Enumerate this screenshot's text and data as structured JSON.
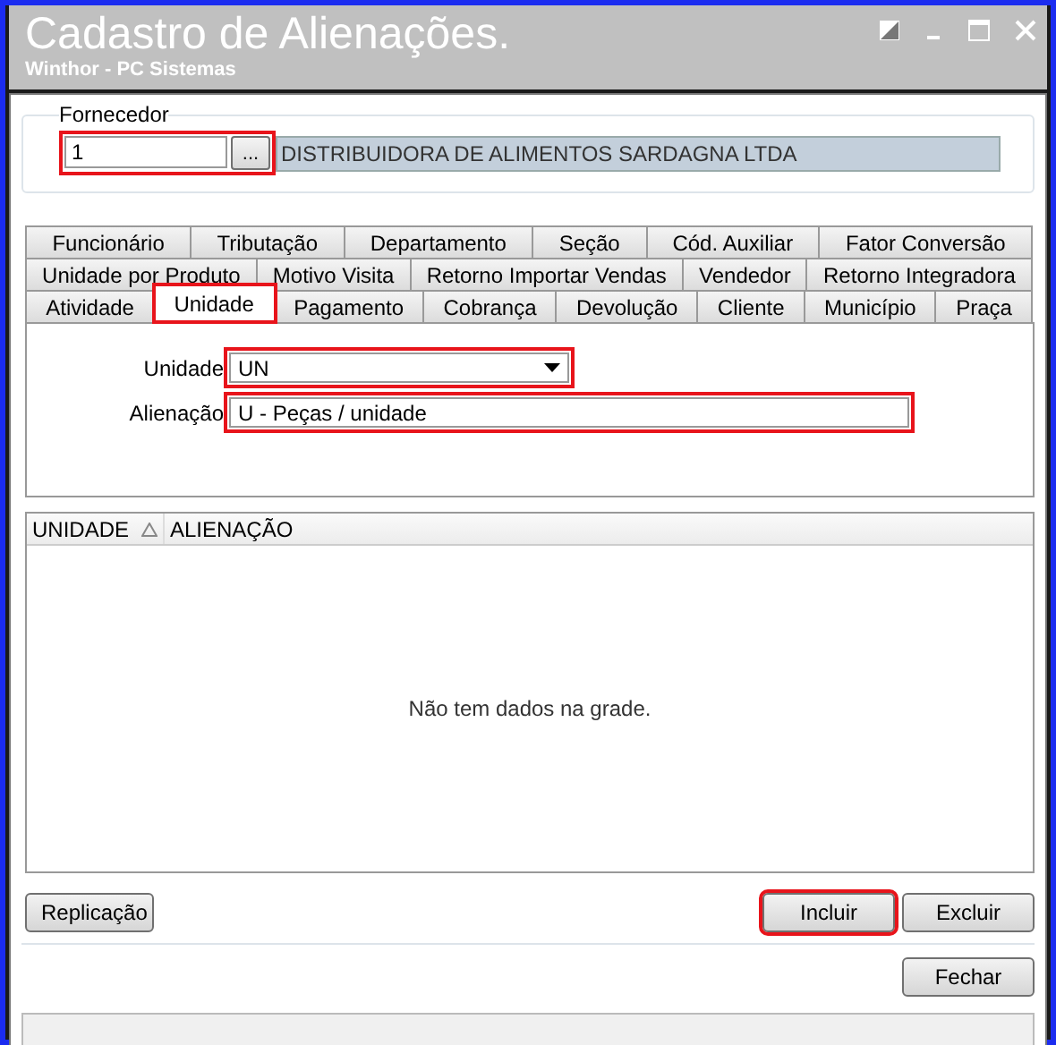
{
  "window": {
    "title": "Cadastro de Alienações.",
    "subtitle": "Winthor - PC Sistemas"
  },
  "fornecedor": {
    "label": "Fornecedor",
    "code": "1",
    "browse": "...",
    "name": "DISTRIBUIDORA DE ALIMENTOS SARDAGNA LTDA",
    "highlighted": true
  },
  "tab_rows": [
    [
      {
        "label": "Funcionário",
        "selected": false,
        "highlighted": false
      },
      {
        "label": "Tributação",
        "selected": false,
        "highlighted": false
      },
      {
        "label": "Departamento",
        "selected": false,
        "highlighted": false
      },
      {
        "label": "Seção",
        "selected": false,
        "highlighted": false
      },
      {
        "label": "Cód. Auxiliar",
        "selected": false,
        "highlighted": false
      },
      {
        "label": "Fator Conversão",
        "selected": false,
        "highlighted": false
      }
    ],
    [
      {
        "label": "Unidade por Produto",
        "selected": false,
        "highlighted": false
      },
      {
        "label": "Motivo Visita",
        "selected": false,
        "highlighted": false
      },
      {
        "label": "Retorno Importar Vendas",
        "selected": false,
        "highlighted": false
      },
      {
        "label": "Vendedor",
        "selected": false,
        "highlighted": false
      },
      {
        "label": "Retorno Integradora",
        "selected": false,
        "highlighted": false
      }
    ],
    [
      {
        "label": "Atividade",
        "selected": false,
        "highlighted": false
      },
      {
        "label": "Unidade",
        "selected": true,
        "highlighted": true
      },
      {
        "label": "Pagamento",
        "selected": false,
        "highlighted": false
      },
      {
        "label": "Cobrança",
        "selected": false,
        "highlighted": false
      },
      {
        "label": "Devolução",
        "selected": false,
        "highlighted": false
      },
      {
        "label": "Cliente",
        "selected": false,
        "highlighted": false
      },
      {
        "label": "Município",
        "selected": false,
        "highlighted": false
      },
      {
        "label": "Praça",
        "selected": false,
        "highlighted": false
      }
    ]
  ],
  "fields": [
    {
      "kind": "dropdown",
      "label": "Unidade",
      "value": "UN",
      "highlighted": true
    },
    {
      "kind": "text",
      "label": "Alienação",
      "value": "U - Peças / unidade",
      "highlighted": true
    }
  ],
  "grid": {
    "columns": [
      {
        "label": "UNIDADE",
        "sorted": true
      },
      {
        "label": "ALIENAÇÃO",
        "sorted": false
      }
    ],
    "empty_message": "Não tem dados na grade."
  },
  "left_buttons": [
    {
      "label": "Replicação",
      "highlighted": false
    }
  ],
  "right_buttons": [
    {
      "label": "Incluir",
      "highlighted": true
    },
    {
      "label": "Excluir",
      "highlighted": false
    }
  ],
  "close_button": {
    "label": "Fechar"
  }
}
